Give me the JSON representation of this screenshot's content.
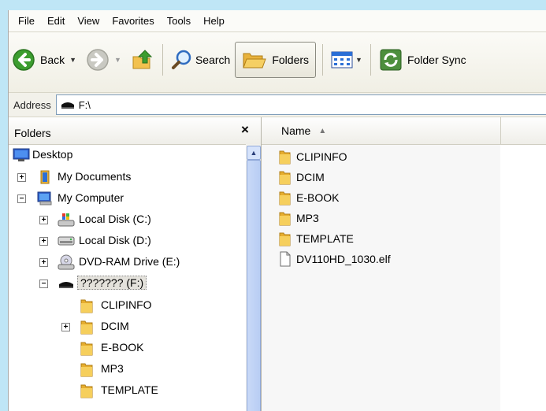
{
  "menu": [
    "File",
    "Edit",
    "View",
    "Favorites",
    "Tools",
    "Help"
  ],
  "toolbar": {
    "back_label": "Back",
    "search_label": "Search",
    "folders_label": "Folders",
    "sync_label": "Folder Sync"
  },
  "address": {
    "label": "Address",
    "value": "F:\\"
  },
  "folders_pane": {
    "title": "Folders",
    "close": "×"
  },
  "tree": {
    "desktop": "Desktop",
    "my_documents": "My Documents",
    "my_computer": "My Computer",
    "local_c": "Local Disk (C:)",
    "local_d": "Local Disk (D:)",
    "dvd": "DVD-RAM Drive (E:)",
    "drive_f": "??????? (F:)",
    "clipinfo": "CLIPINFO",
    "dcim": "DCIM",
    "ebook": "E-BOOK",
    "mp3": "MP3",
    "template": "TEMPLATE"
  },
  "list_header": {
    "name": "Name",
    "sort": "▲"
  },
  "files": [
    "CLIPINFO",
    "DCIM",
    "E-BOOK",
    "MP3",
    "TEMPLATE",
    "DV110HD_1030.elf"
  ],
  "colors": {
    "folder": "#f2c14e",
    "back_green": "#3c9d2f",
    "selection": "#e4e2dc"
  }
}
